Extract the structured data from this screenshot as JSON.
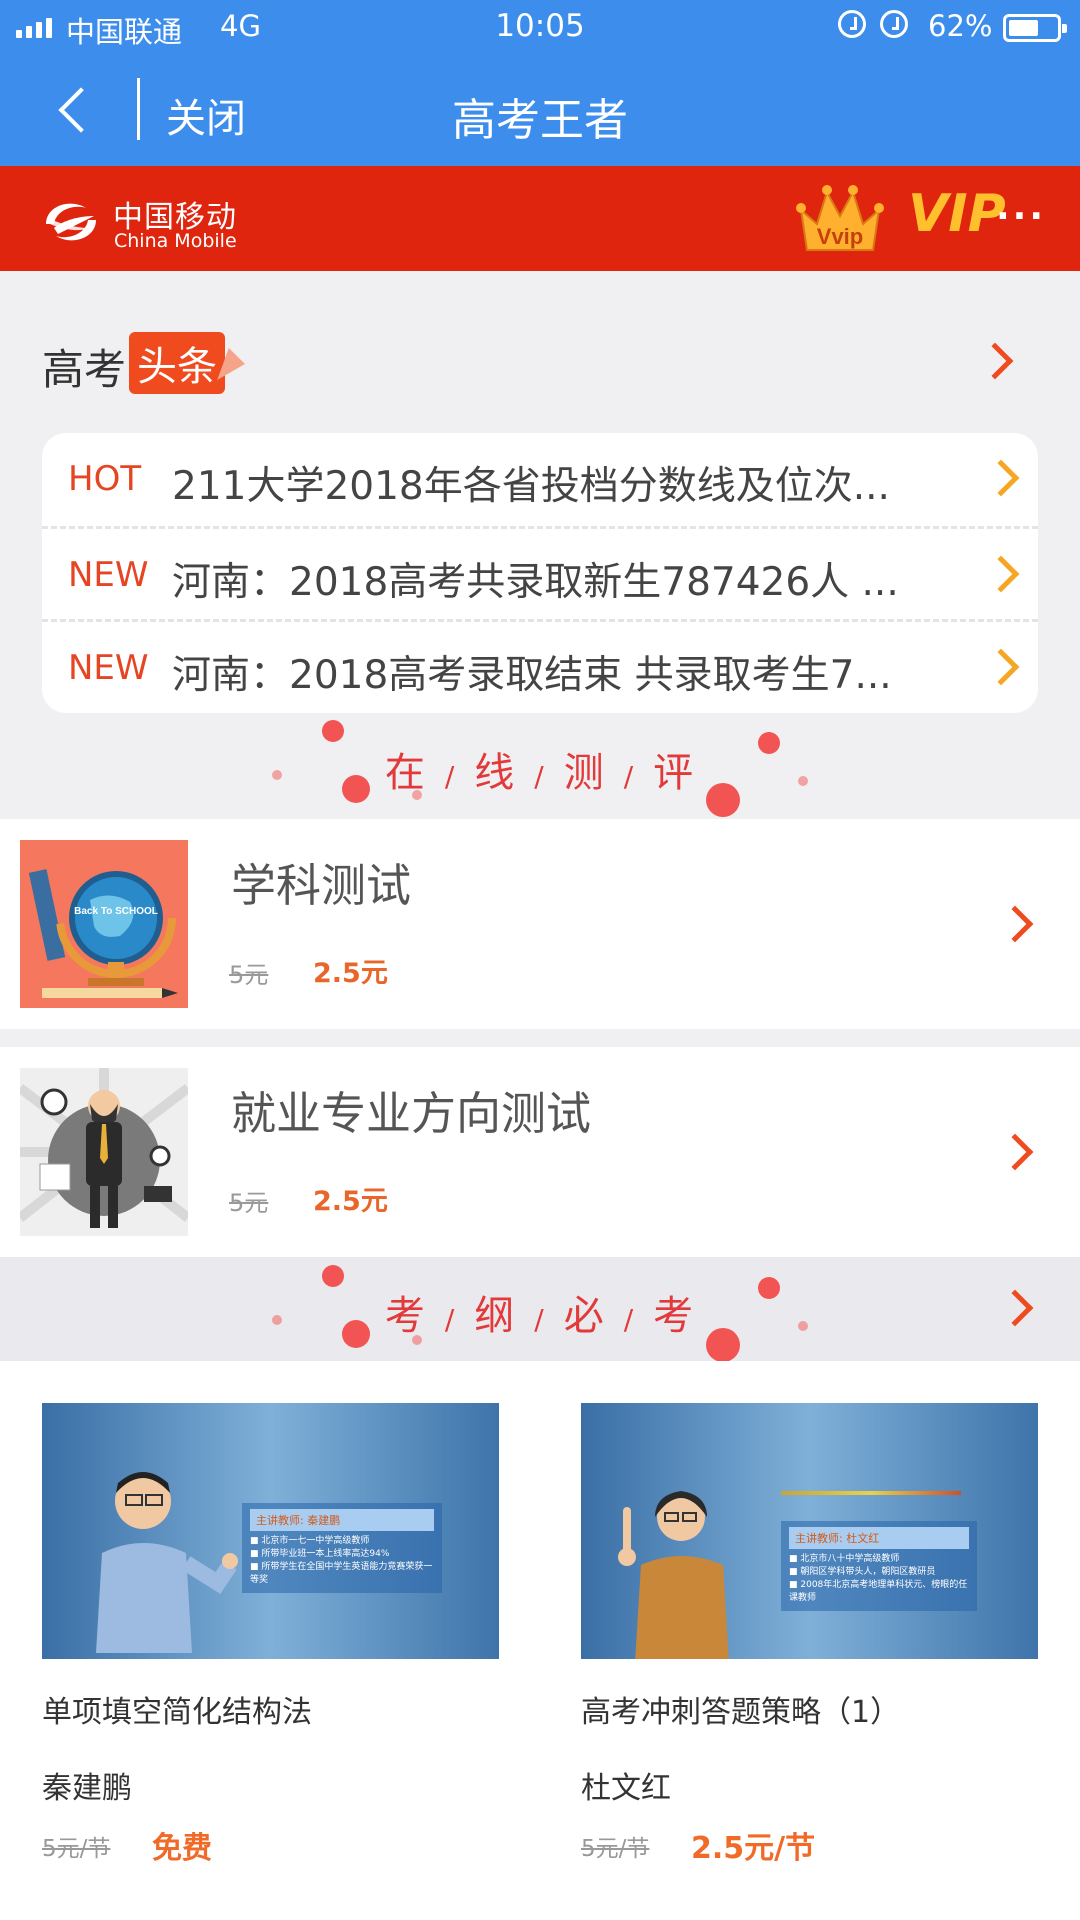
{
  "status_bar": {
    "carrier": "中国联通",
    "network": "4G",
    "time": "10:05",
    "battery_percent": "62%",
    "battery_level": 0.62
  },
  "nav": {
    "close_label": "关闭",
    "title": "高考王者"
  },
  "banner": {
    "brand_cn": "中国移动",
    "brand_en": "China Mobile",
    "vvip_label": "Vvip",
    "vip_label": "VIP",
    "more_label": "···"
  },
  "headlines": {
    "title": "高考",
    "badge": "头条",
    "items": [
      {
        "tag": "HOT",
        "text": "211大学2018年各省投档分数线及位次..."
      },
      {
        "tag": "NEW",
        "text": "河南：2018高考共录取新生787426人 ..."
      },
      {
        "tag": "NEW",
        "text": "河南：2018高考录取结束 共录取考生7..."
      }
    ]
  },
  "online_test": {
    "section_chars": [
      "在",
      "线",
      "测",
      "评"
    ],
    "separator": "/",
    "items": [
      {
        "name": "学科测试",
        "old_price": "5元",
        "new_price": "2.5元",
        "thumb_text": "Back To SCHOOL"
      },
      {
        "name": "就业专业方向测试",
        "old_price": "5元",
        "new_price": "2.5元"
      }
    ]
  },
  "exam_outline": {
    "section_chars": [
      "考",
      "纲",
      "必",
      "考"
    ],
    "courses": [
      {
        "name": "单项填空简化结构法",
        "teacher": "秦建鹏",
        "old_price": "5元/节",
        "new_price": "免费",
        "panel_head": "主讲教师: 秦建鹏",
        "panel_lines": [
          "■ 北京市一七一中学高级教师",
          "■ 所带毕业班一本上线率高达94%",
          "■ 所带学生在全国中学生英语能力竞赛荣获一等奖"
        ]
      },
      {
        "name": "高考冲刺答题策略（1）",
        "teacher": "杜文红",
        "old_price": "5元/节",
        "new_price": "2.5元/节",
        "panel_head": "主讲教师: 杜文红",
        "panel_lines": [
          "■ 北京市八十中学高级教师",
          "■ 朝阳区学科带头人，朝阳区教研员",
          "■ 2008年北京高考地理单科状元、榜眼的任课教师"
        ]
      }
    ]
  },
  "colors": {
    "nav_blue": "#3d8ded",
    "banner_red": "#e0250f",
    "accent_orange": "#f06a28",
    "chevron_red": "#f04a1f",
    "chevron_orange": "#f5a623"
  }
}
